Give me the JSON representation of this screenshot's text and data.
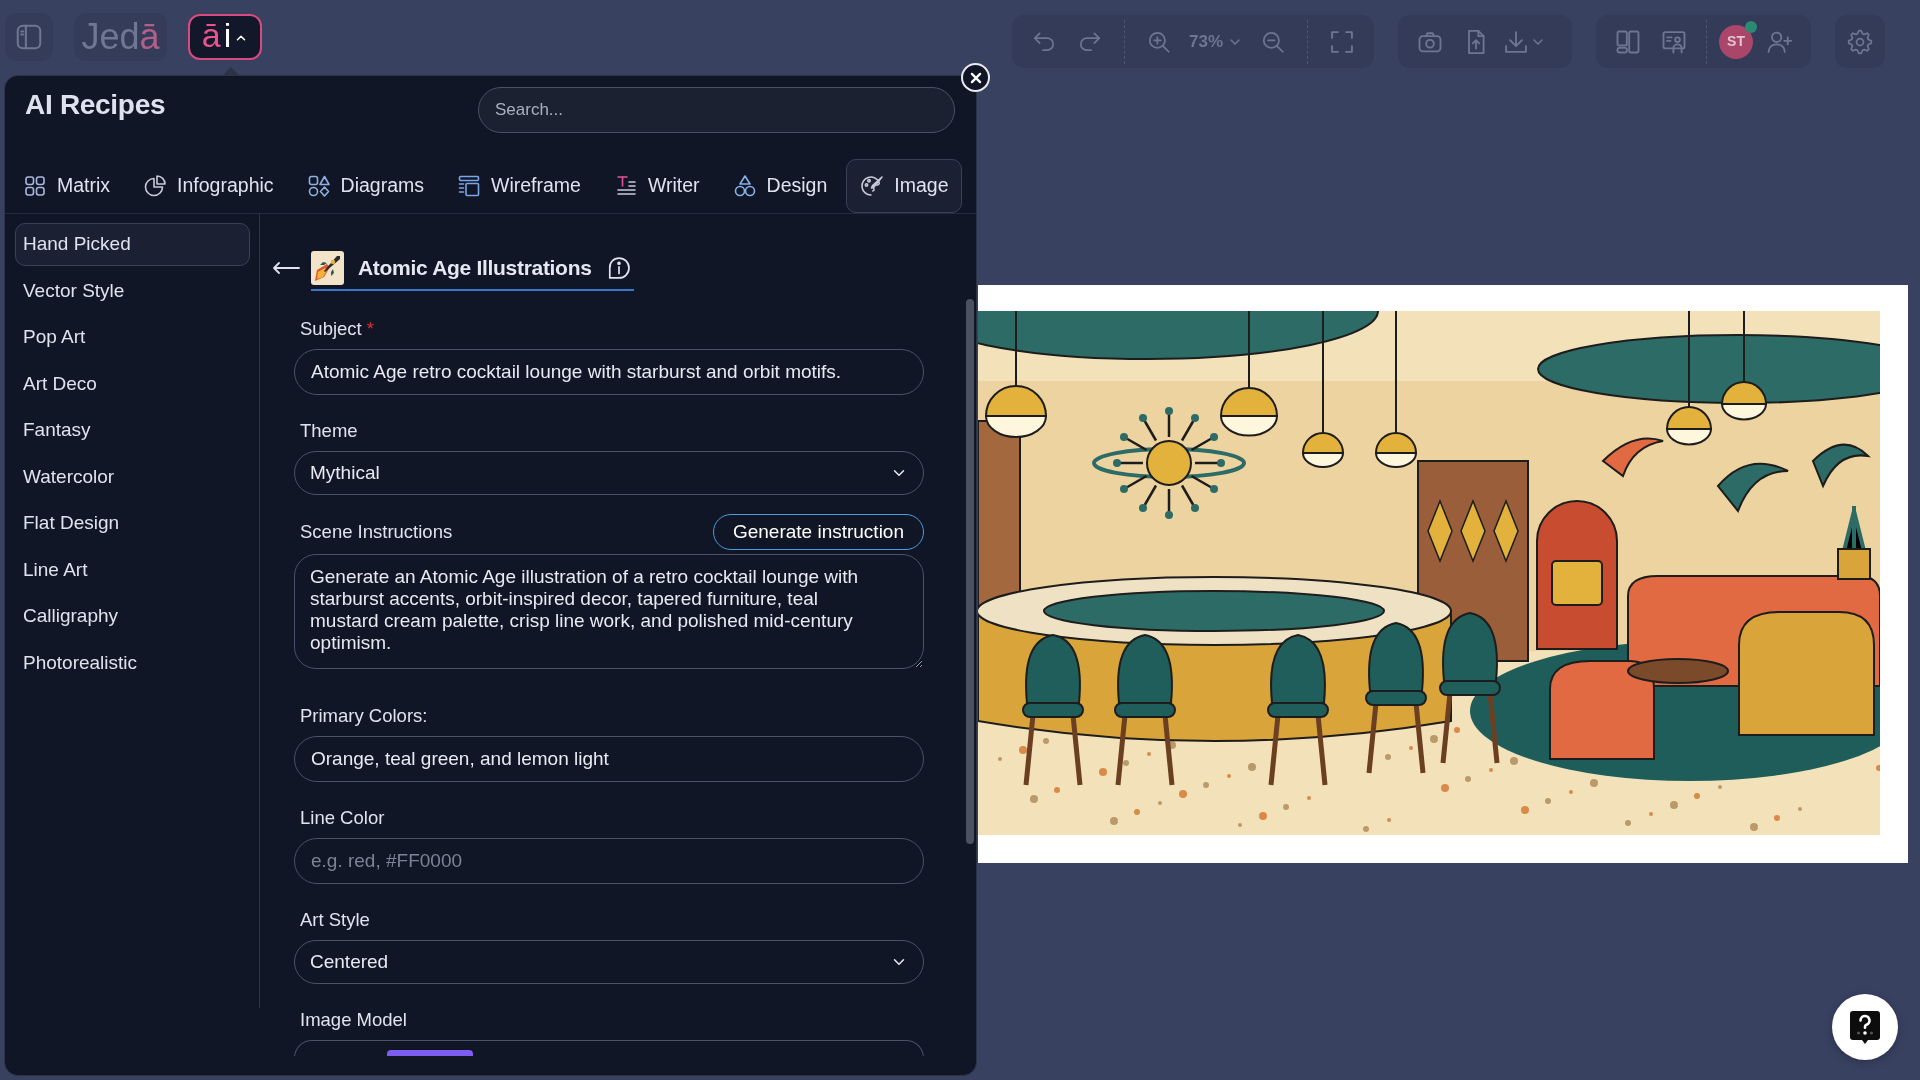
{
  "topbar": {
    "logo": {
      "text": "Jed",
      "accent": "ā"
    },
    "ai_button": {
      "accent": "ā",
      "text": "i",
      "expanded": true
    },
    "zoom": "73%",
    "avatar": {
      "initials": "ST",
      "online": true
    }
  },
  "recipes_panel": {
    "title": "AI Recipes",
    "search": {
      "placeholder": "Search..."
    },
    "tabs": [
      {
        "label": "Matrix",
        "kind": "matrix",
        "selected": false
      },
      {
        "label": "Infographic",
        "kind": "infographic",
        "selected": false
      },
      {
        "label": "Diagrams",
        "kind": "diagrams",
        "selected": false
      },
      {
        "label": "Wireframe",
        "kind": "wireframe",
        "selected": false
      },
      {
        "label": "Writer",
        "kind": "writer",
        "selected": false
      },
      {
        "label": "Design",
        "kind": "design",
        "selected": false
      },
      {
        "label": "Image",
        "kind": "image",
        "selected": true
      }
    ],
    "categories": [
      {
        "label": "Hand Picked",
        "selected": true
      },
      {
        "label": "Vector Style",
        "selected": false
      },
      {
        "label": "Pop Art",
        "selected": false
      },
      {
        "label": "Art Deco",
        "selected": false
      },
      {
        "label": "Fantasy",
        "selected": false
      },
      {
        "label": "Watercolor",
        "selected": false
      },
      {
        "label": "Flat Design",
        "selected": false
      },
      {
        "label": "Line Art",
        "selected": false
      },
      {
        "label": "Calligraphy",
        "selected": false
      },
      {
        "label": "Photorealistic",
        "selected": false
      }
    ],
    "recipe": {
      "title": "Atomic Age Illustrations"
    },
    "fields": [
      {
        "kind": "text",
        "label": "Subject",
        "required_mark": "*",
        "value": "Atomic Age retro cocktail lounge with starburst and orbit motifs."
      },
      {
        "kind": "select",
        "label": "Theme",
        "value": "Mythical"
      },
      {
        "kind": "textarea",
        "label": "Scene Instructions",
        "action": "Generate instruction",
        "value": "Generate an Atomic Age illustration of a retro cocktail lounge with starburst accents, orbit-inspired decor, tapered furniture, teal mustard cream palette, crisp line work, and polished mid-century optimism."
      },
      {
        "kind": "text",
        "label": "Primary Colors:",
        "value": "Orange, teal green, and lemon light"
      },
      {
        "kind": "text",
        "label": "Line Color",
        "placeholder": "e.g. red, #FF0000"
      },
      {
        "kind": "select",
        "label": "Art Style",
        "value": "Centered"
      },
      {
        "kind": "model",
        "label": "Image Model"
      }
    ]
  }
}
